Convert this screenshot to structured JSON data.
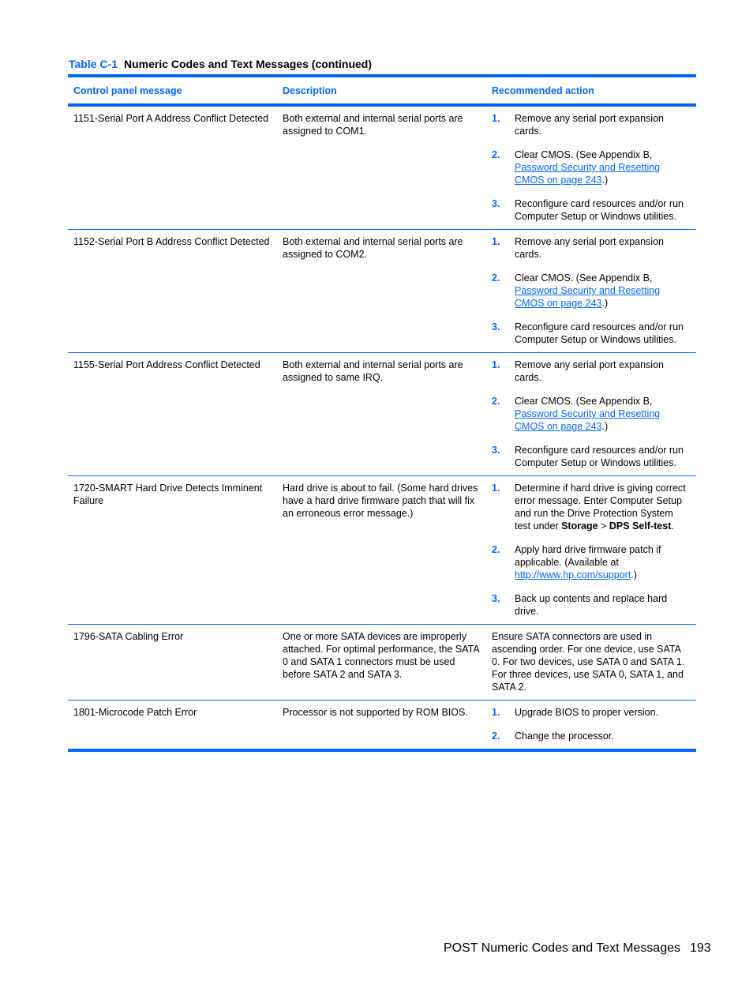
{
  "caption": {
    "label": "Table C-1",
    "title": "Numeric Codes and Text Messages (continued)"
  },
  "table": {
    "headers": [
      "Control panel message",
      "Description",
      "Recommended action"
    ],
    "rows": [
      {
        "message": "1151-Serial Port A Address Conflict Detected",
        "description": "Both external and internal serial ports are assigned to COM1.",
        "steps": [
          {
            "num": "1.",
            "text": "Remove any serial port expansion cards."
          },
          {
            "num": "2.",
            "pre": "Clear CMOS. (See Appendix B, ",
            "link": "Password Security and Resetting CMOS on page 243",
            "post": ".)"
          },
          {
            "num": "3.",
            "text": "Reconfigure card resources and/or run Computer Setup or Windows utilities."
          }
        ]
      },
      {
        "message": "1152-Serial Port B Address Conflict Detected",
        "description": "Both external and internal serial ports are assigned to COM2.",
        "steps": [
          {
            "num": "1.",
            "text": "Remove any serial port expansion cards."
          },
          {
            "num": "2.",
            "pre": "Clear CMOS. (See Appendix B, ",
            "link": "Password Security and Resetting CMOS on page 243",
            "post": ".)"
          },
          {
            "num": "3.",
            "text": "Reconfigure card resources and/or run Computer Setup or Windows utilities."
          }
        ]
      },
      {
        "message": "1155-Serial Port Address Conflict Detected",
        "description": "Both external and internal serial ports are assigned to same IRQ.",
        "steps": [
          {
            "num": "1.",
            "text": "Remove any serial port expansion cards."
          },
          {
            "num": "2.",
            "pre": "Clear CMOS. (See Appendix B, ",
            "link": "Password Security and Resetting CMOS on page 243",
            "post": ".)"
          },
          {
            "num": "3.",
            "text": "Reconfigure card resources and/or run Computer Setup or Windows utilities."
          }
        ]
      },
      {
        "message": "1720-SMART Hard Drive Detects Imminent Failure",
        "description": "Hard drive is about to fail. (Some hard drives have a hard drive firmware patch that will fix an erroneous error message.)",
        "steps": [
          {
            "num": "1.",
            "pre": "Determine if hard drive is giving correct error message. Enter Computer Setup and run the Drive Protection System test under ",
            "bold1": "Storage",
            "mid": " > ",
            "bold2": "DPS Self-test",
            "post": "."
          },
          {
            "num": "2.",
            "pre": "Apply hard drive firmware patch if applicable. (Available at ",
            "link": "http://www.hp.com/support",
            "post": ".)"
          },
          {
            "num": "3.",
            "text": "Back up contents and replace hard drive."
          }
        ]
      },
      {
        "message": "1796-SATA Cabling Error",
        "description": "One or more SATA devices are improperly attached. For optimal performance, the SATA 0 and SATA 1 connectors must be used before SATA 2 and SATA 3.",
        "action_text": "Ensure SATA connectors are used in ascending order. For one device, use SATA 0. For two devices, use SATA 0 and SATA 1. For three devices, use SATA 0, SATA 1, and SATA 2."
      },
      {
        "message": "1801-Microcode Patch Error",
        "description": "Processor is not supported by ROM BIOS.",
        "steps": [
          {
            "num": "1.",
            "text": "Upgrade BIOS to proper version."
          },
          {
            "num": "2.",
            "text": "Change the processor."
          }
        ]
      }
    ]
  },
  "footer": {
    "section": "POST Numeric Codes and Text Messages",
    "page": "193"
  }
}
